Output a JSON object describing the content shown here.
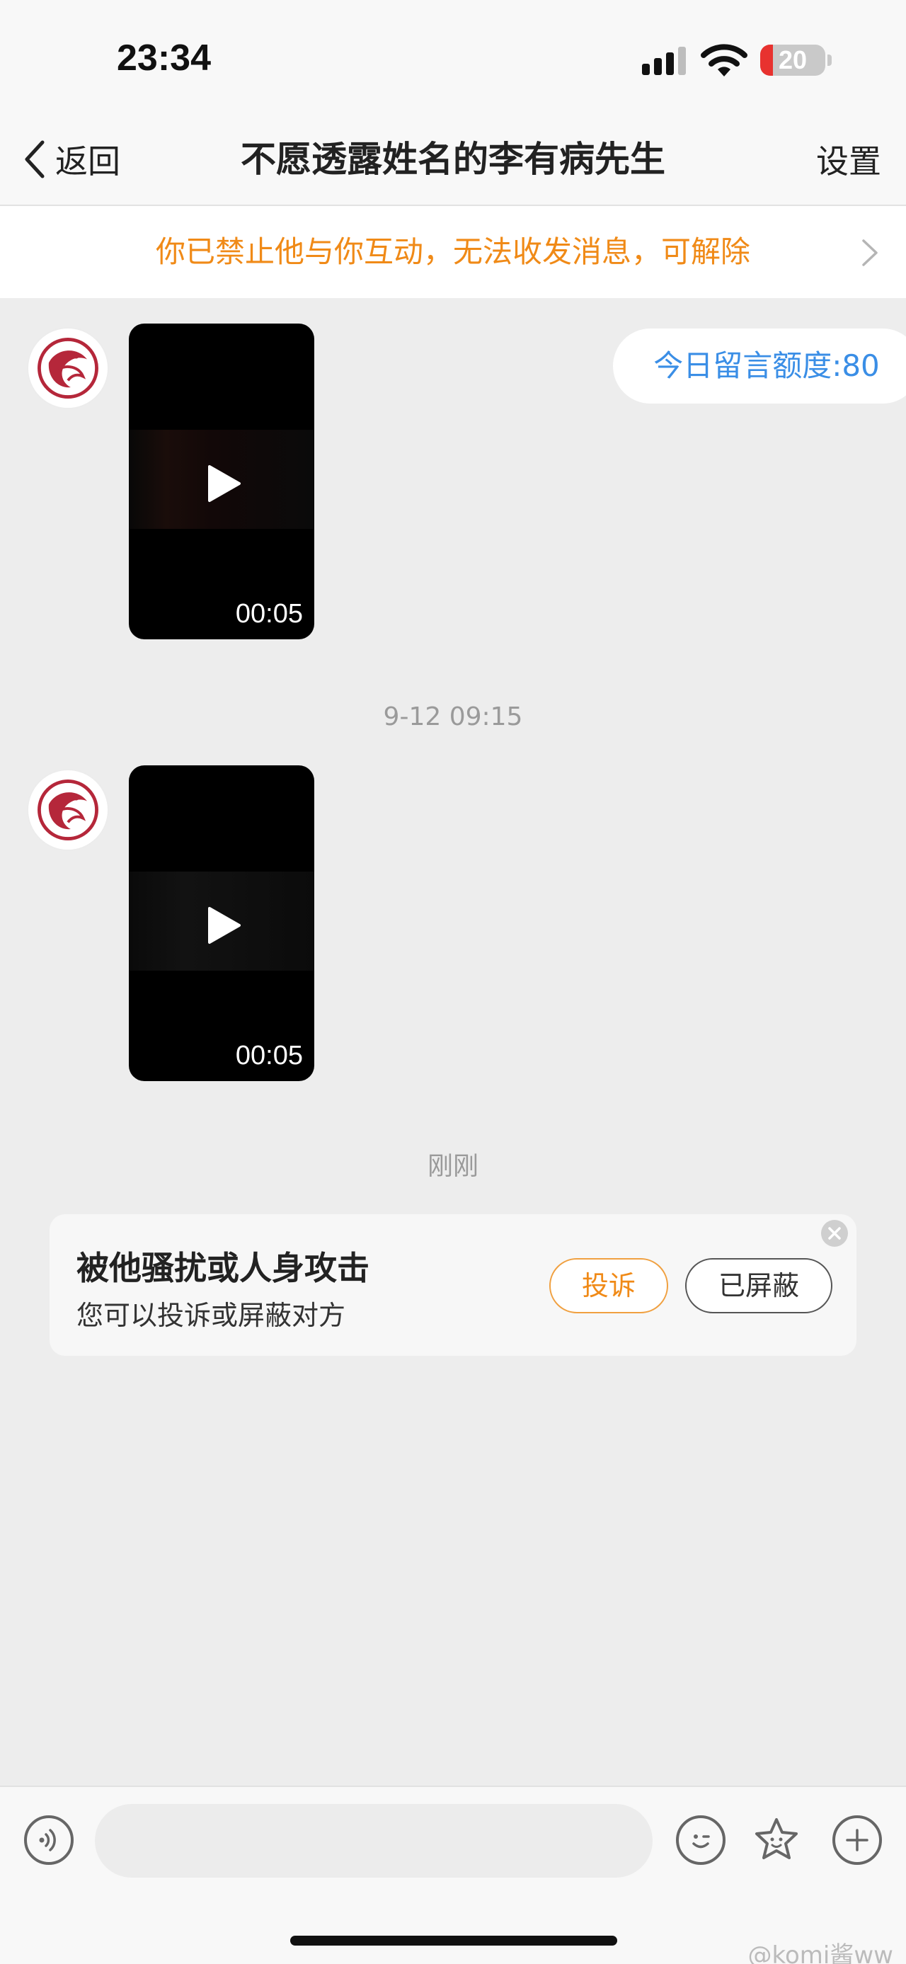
{
  "status_bar": {
    "time": "23:34",
    "battery": "20",
    "battery_level_percent": 20,
    "icons": [
      "signal-icon",
      "wifi-icon",
      "battery-icon"
    ]
  },
  "nav": {
    "back_label": "返回",
    "title": "不愿透露姓名的李有病先生",
    "settings_label": "设置"
  },
  "banner": {
    "text": "你已禁止他与你互动，无法收发消息，可解除",
    "color": "#f08a17"
  },
  "quota": {
    "text": "今日留言额度:80",
    "color": "#3a8ee6"
  },
  "messages": [
    {
      "type": "video",
      "duration": "00:05"
    },
    {
      "timestamp": "9-12 09:15"
    },
    {
      "type": "video",
      "duration": "00:05"
    },
    {
      "timestamp": "刚刚"
    }
  ],
  "harassment_card": {
    "title": "被他骚扰或人身攻击",
    "subtitle": "您可以投诉或屏蔽对方",
    "report_label": "投诉",
    "blocked_label": "已屏蔽",
    "accent": "#f08a17"
  },
  "composer": {
    "placeholder": "",
    "icons": [
      "voice-icon",
      "emoji-icon",
      "sticker-icon",
      "plus-icon"
    ]
  },
  "watermark": "@komi酱ww"
}
